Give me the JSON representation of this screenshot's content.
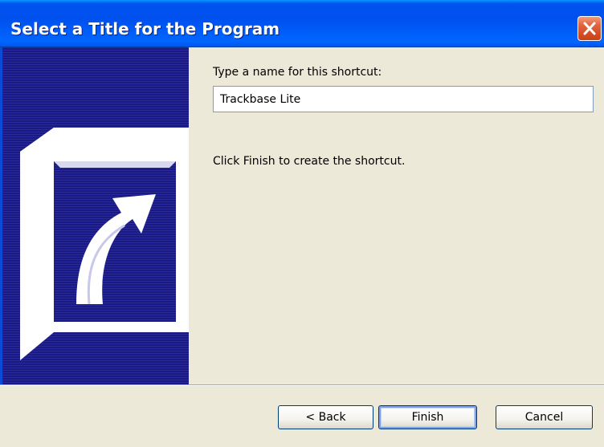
{
  "window": {
    "title": "Select a Title for the Program"
  },
  "content": {
    "prompt_label": "Type a name for this shortcut:",
    "name_value": "Trackbase Lite",
    "finish_hint": "Click Finish to create the shortcut."
  },
  "buttons": {
    "back_label": "< Back",
    "finish_label": "Finish",
    "cancel_label": "Cancel"
  },
  "icons": {
    "close": "close-icon",
    "banner": "shortcut-arrow-icon"
  },
  "colors": {
    "titlebar": "#0050ee",
    "banner": "#1f1f8a",
    "close": "#d24c23",
    "background": "#ece9d8"
  }
}
